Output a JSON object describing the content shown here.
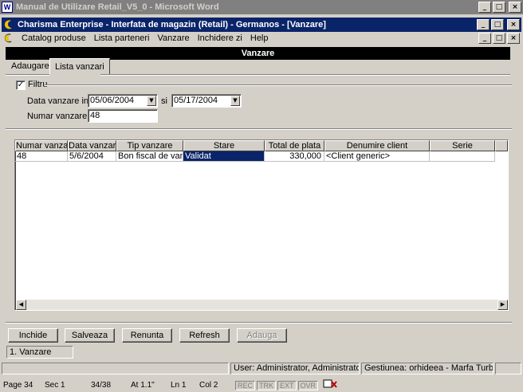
{
  "outer_window": {
    "title": "Manual de Utilizare Retail_V5_0 - Microsoft Word",
    "icon": "W",
    "buttons": [
      "_",
      "□",
      "×"
    ]
  },
  "app_window": {
    "title": "Charisma Enterprise - Interfata de magazin (Retail) - Germanos - [Vanzare]",
    "buttons": [
      "_",
      "□",
      "×"
    ]
  },
  "menu": [
    "Catalog produse",
    "Lista parteneri",
    "Vanzare",
    "Inchidere zi",
    "Help"
  ],
  "form_title": "Vanzare",
  "tabs": [
    "Adaugare",
    "Lista vanzari"
  ],
  "filter": {
    "checkbox_label": "Filtru",
    "checked": true,
    "date_label": "Data vanzare intre",
    "date_from": "05/06/2004",
    "si_label": "si",
    "date_to": "05/17/2004",
    "number_label": "Numar vanzare",
    "number_value": "48"
  },
  "grid": {
    "columns": [
      "Numar vanzare",
      "Data vanzarii",
      "Tip vanzare",
      "Stare",
      "Total de plata",
      "Denumire client",
      "Serie"
    ],
    "rows": [
      [
        "48",
        "5/6/2004",
        "Bon fiscal de vanzare",
        "Validat",
        "330,000",
        "<Client generic>",
        ""
      ]
    ]
  },
  "buttons": {
    "inchide": "Inchide",
    "salveaza": "Salveaza",
    "renunta": "Renunta",
    "refresh": "Refresh",
    "adauga": "Adauga"
  },
  "window_list": "1. Vanzare",
  "status": {
    "user": "User: Administrator, Administrator",
    "gestiune": "Gestiunea: orhideea - Marfa Turbo Carre"
  },
  "word_status": {
    "page": "Page 34",
    "sec": "Sec 1",
    "pages": "34/38",
    "at": "At 1.1\"",
    "ln": "Ln 1",
    "col": "Col 2",
    "rec": "REC",
    "trk": "TRK",
    "ext": "EXT",
    "ovr": "OVR"
  }
}
